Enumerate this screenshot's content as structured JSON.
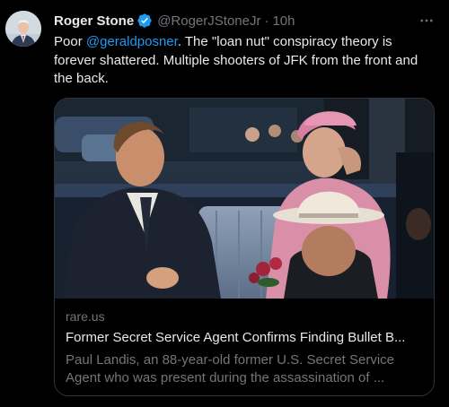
{
  "tweet": {
    "display_name": "Roger Stone",
    "handle": "@RogerJStoneJr",
    "separator": "·",
    "time": "10h",
    "text_before": "Poor ",
    "mention": "@geraldposner",
    "text_after": ". The \"loan nut\" conspiracy theory is forever shattered. Multiple shooters of JFK from the front and the back.",
    "verified_icon": "verified-badge-icon",
    "more_icon": "more-horizontal-icon"
  },
  "card": {
    "domain": "rare.us",
    "title": "Former Secret Service Agent Confirms Finding Bullet B...",
    "description": "Paul Landis, an 88-year-old former U.S. Secret Service Agent who was present during the assassination of ..."
  },
  "colors": {
    "background": "#000000",
    "text": "#e7e9ea",
    "muted": "#71767b",
    "link": "#1d9bf0",
    "border": "#2f3336"
  }
}
